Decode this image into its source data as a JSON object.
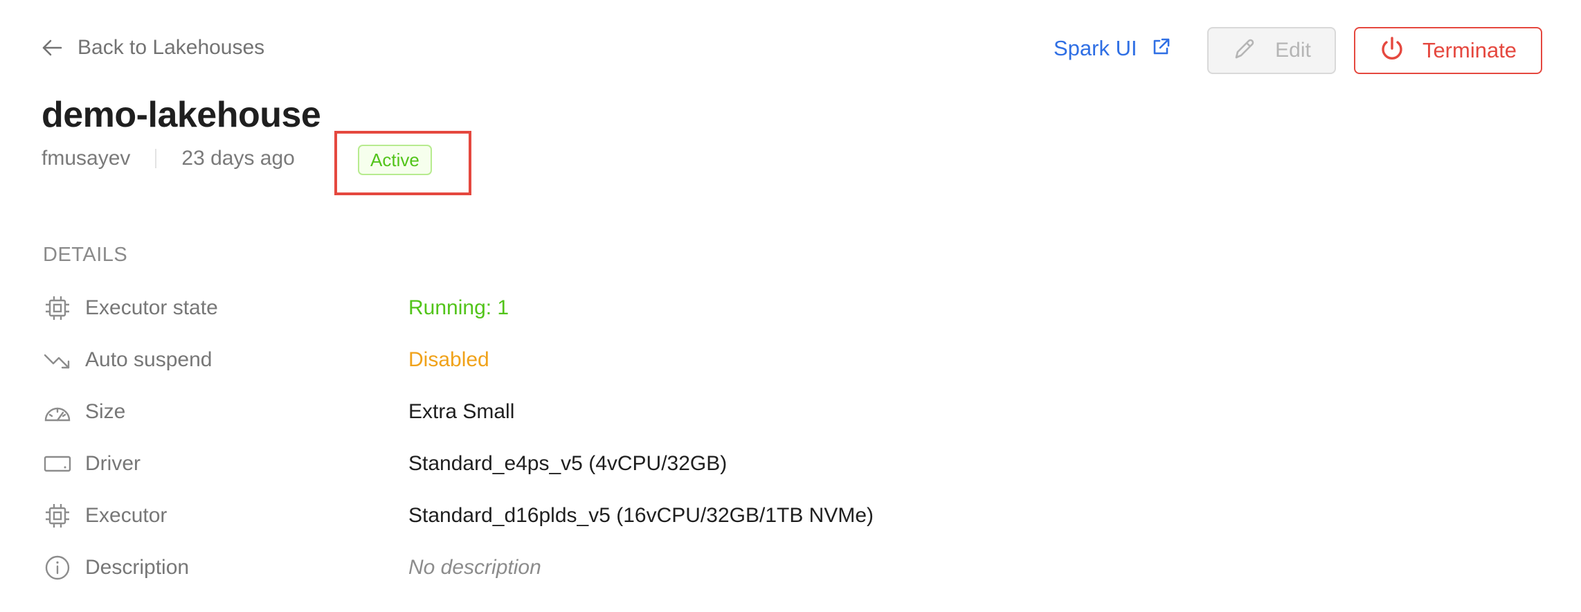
{
  "nav": {
    "back_label": "Back to Lakehouses"
  },
  "actions": {
    "spark_ui_label": "Spark UI",
    "edit_label": "Edit",
    "terminate_label": "Terminate"
  },
  "lakehouse": {
    "name": "demo-lakehouse",
    "owner": "fmusayev",
    "created": "23 days ago",
    "status": "Active"
  },
  "details": {
    "heading": "DETAILS",
    "rows": [
      {
        "label": "Executor state",
        "value": "Running: 1",
        "icon": "cpu-icon"
      },
      {
        "label": "Auto suspend",
        "value": "Disabled",
        "icon": "trend-down-icon"
      },
      {
        "label": "Size",
        "value": "Extra Small",
        "icon": "gauge-icon"
      },
      {
        "label": "Driver",
        "value": "Standard_e4ps_v5 (4vCPU/32GB)",
        "icon": "drive-icon"
      },
      {
        "label": "Executor",
        "value": "Standard_d16plds_v5 (16vCPU/32GB/1TB NVMe)",
        "icon": "cpu-icon"
      },
      {
        "label": "Description",
        "value": "No description",
        "icon": "info-icon"
      }
    ]
  },
  "colors": {
    "accent_blue": "#2f6fe4",
    "danger_red": "#e5483f",
    "success_green": "#52c41a",
    "warning_orange": "#f0a21a"
  }
}
